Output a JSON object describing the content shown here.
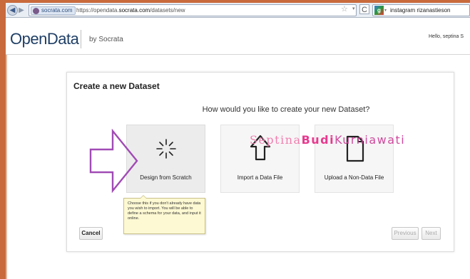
{
  "browser": {
    "site_badge": "socrata.com",
    "url_prefix": "https://opendata.",
    "url_domain": "socrata.com",
    "url_path": "/datasets/new",
    "search_text": "instagram rizanastieson",
    "back_glyph": "◀",
    "fwd_glyph": "▶",
    "star_glyph": "☆",
    "dropdown_glyph": "▾",
    "reload_glyph": "C",
    "google_glyph": "g"
  },
  "header": {
    "logo_open": "Open",
    "logo_data": "Data",
    "by_text": "by Socrata",
    "greeting": "Hello, septina  S"
  },
  "dialog": {
    "title": "Create a new Dataset",
    "question": "How would you like to create your new Dataset?",
    "options": [
      {
        "label": "Design from Scratch",
        "icon": "sparkle-icon",
        "selected": true
      },
      {
        "label": "Import a Data File",
        "icon": "upload-arrow-icon",
        "selected": false
      },
      {
        "label": "Upload a Non-Data File",
        "icon": "document-icon",
        "selected": false
      }
    ],
    "tooltip": "Choose this if you don't already have data you wish to import. You will be able to define a schema for your data, and input it online.",
    "cancel_label": "Cancel",
    "previous_label": "Previous",
    "next_label": "Next"
  },
  "overlay": {
    "watermark_part1": "Septina",
    "watermark_part2": "Budi",
    "watermark_part3": "Kurniawati",
    "arrow_color": "#a14bb5"
  },
  "colors": {
    "frame": "#c96a3c",
    "logo": "#1f3f66",
    "tooltip_bg": "#fdf9d3"
  }
}
